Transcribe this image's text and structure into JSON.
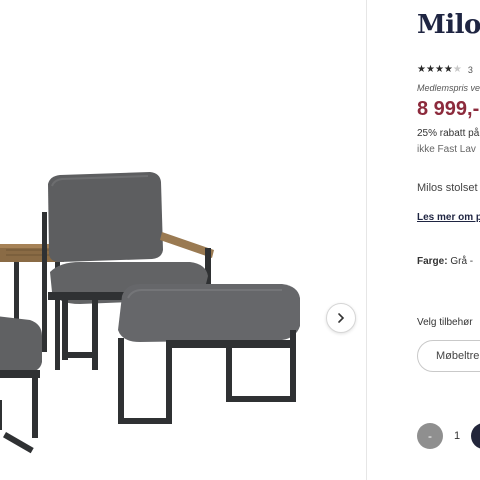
{
  "product": {
    "title": "Milos",
    "rating": {
      "stars": 3.5,
      "max": 5,
      "count_text": "3"
    },
    "member_text": "Medlemspris ve",
    "price": "8 999,-",
    "discount_text": "25% rabatt på",
    "discount_sub": "ikke Fast Lav",
    "description": "Milos stolset",
    "read_more": "Les mer om p",
    "color_label": "Farge:",
    "color_value": "Grå - ",
    "accessories_label": "Velg tilbehør",
    "accessory_chip": "Møbeltre",
    "quantity": {
      "minus": "-",
      "value": "1",
      "plus": "+"
    }
  },
  "gallery": {
    "next_icon": "chevron-right-icon"
  },
  "colors": {
    "title": "#1f2542",
    "price": "#8c2a3c",
    "cushion": "#5d5e60",
    "frame": "#2f3133",
    "wood": "#9a7a52"
  }
}
